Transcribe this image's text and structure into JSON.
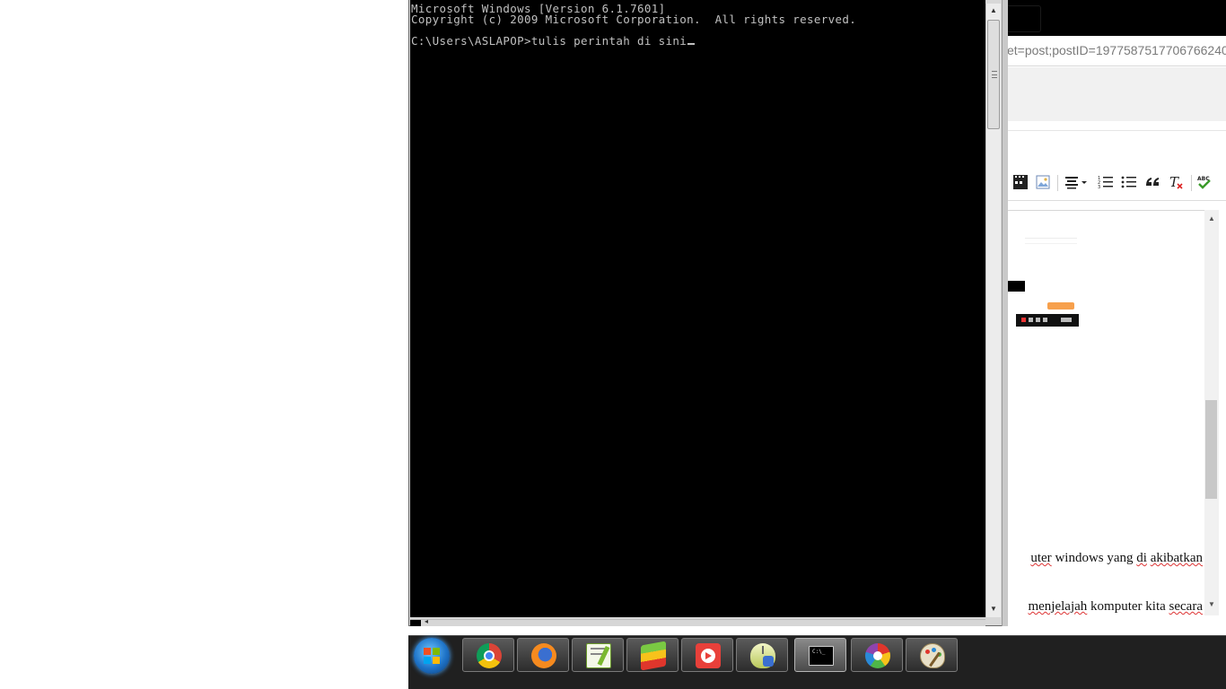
{
  "browser": {
    "url_fragment": "et=post;postID=1977587517706766240",
    "editor": {
      "line1_pre": "uter",
      "line1_mid": " windows yang ",
      "line1_di": "di",
      "line1_space": " ",
      "line1_post": "akibatkan",
      "line2_pre": "menjelajah",
      "line2_mid": " komputer kita ",
      "line2_post": "secara"
    },
    "toolbar": {
      "icons": [
        "video-icon",
        "image-icon",
        "align-icon",
        "numbered-list-icon",
        "bullet-list-icon",
        "quote-icon",
        "clear-format-icon",
        "spellcheck-icon"
      ]
    }
  },
  "console": {
    "line1": "Microsoft Windows [Version 6.1.7601]",
    "line2": "Copyright (c) 2009 Microsoft Corporation.  All rights reserved.",
    "prompt": "C:\\Users\\ASLAPOP>",
    "command": "tulis perintah di sini"
  },
  "taskbar": {
    "items": [
      "chrome",
      "firefox",
      "notepad-plus-plus",
      "bluestacks",
      "video-player",
      "mouse-utility",
      "command-prompt",
      "picasa",
      "paint"
    ],
    "active": "command-prompt"
  }
}
